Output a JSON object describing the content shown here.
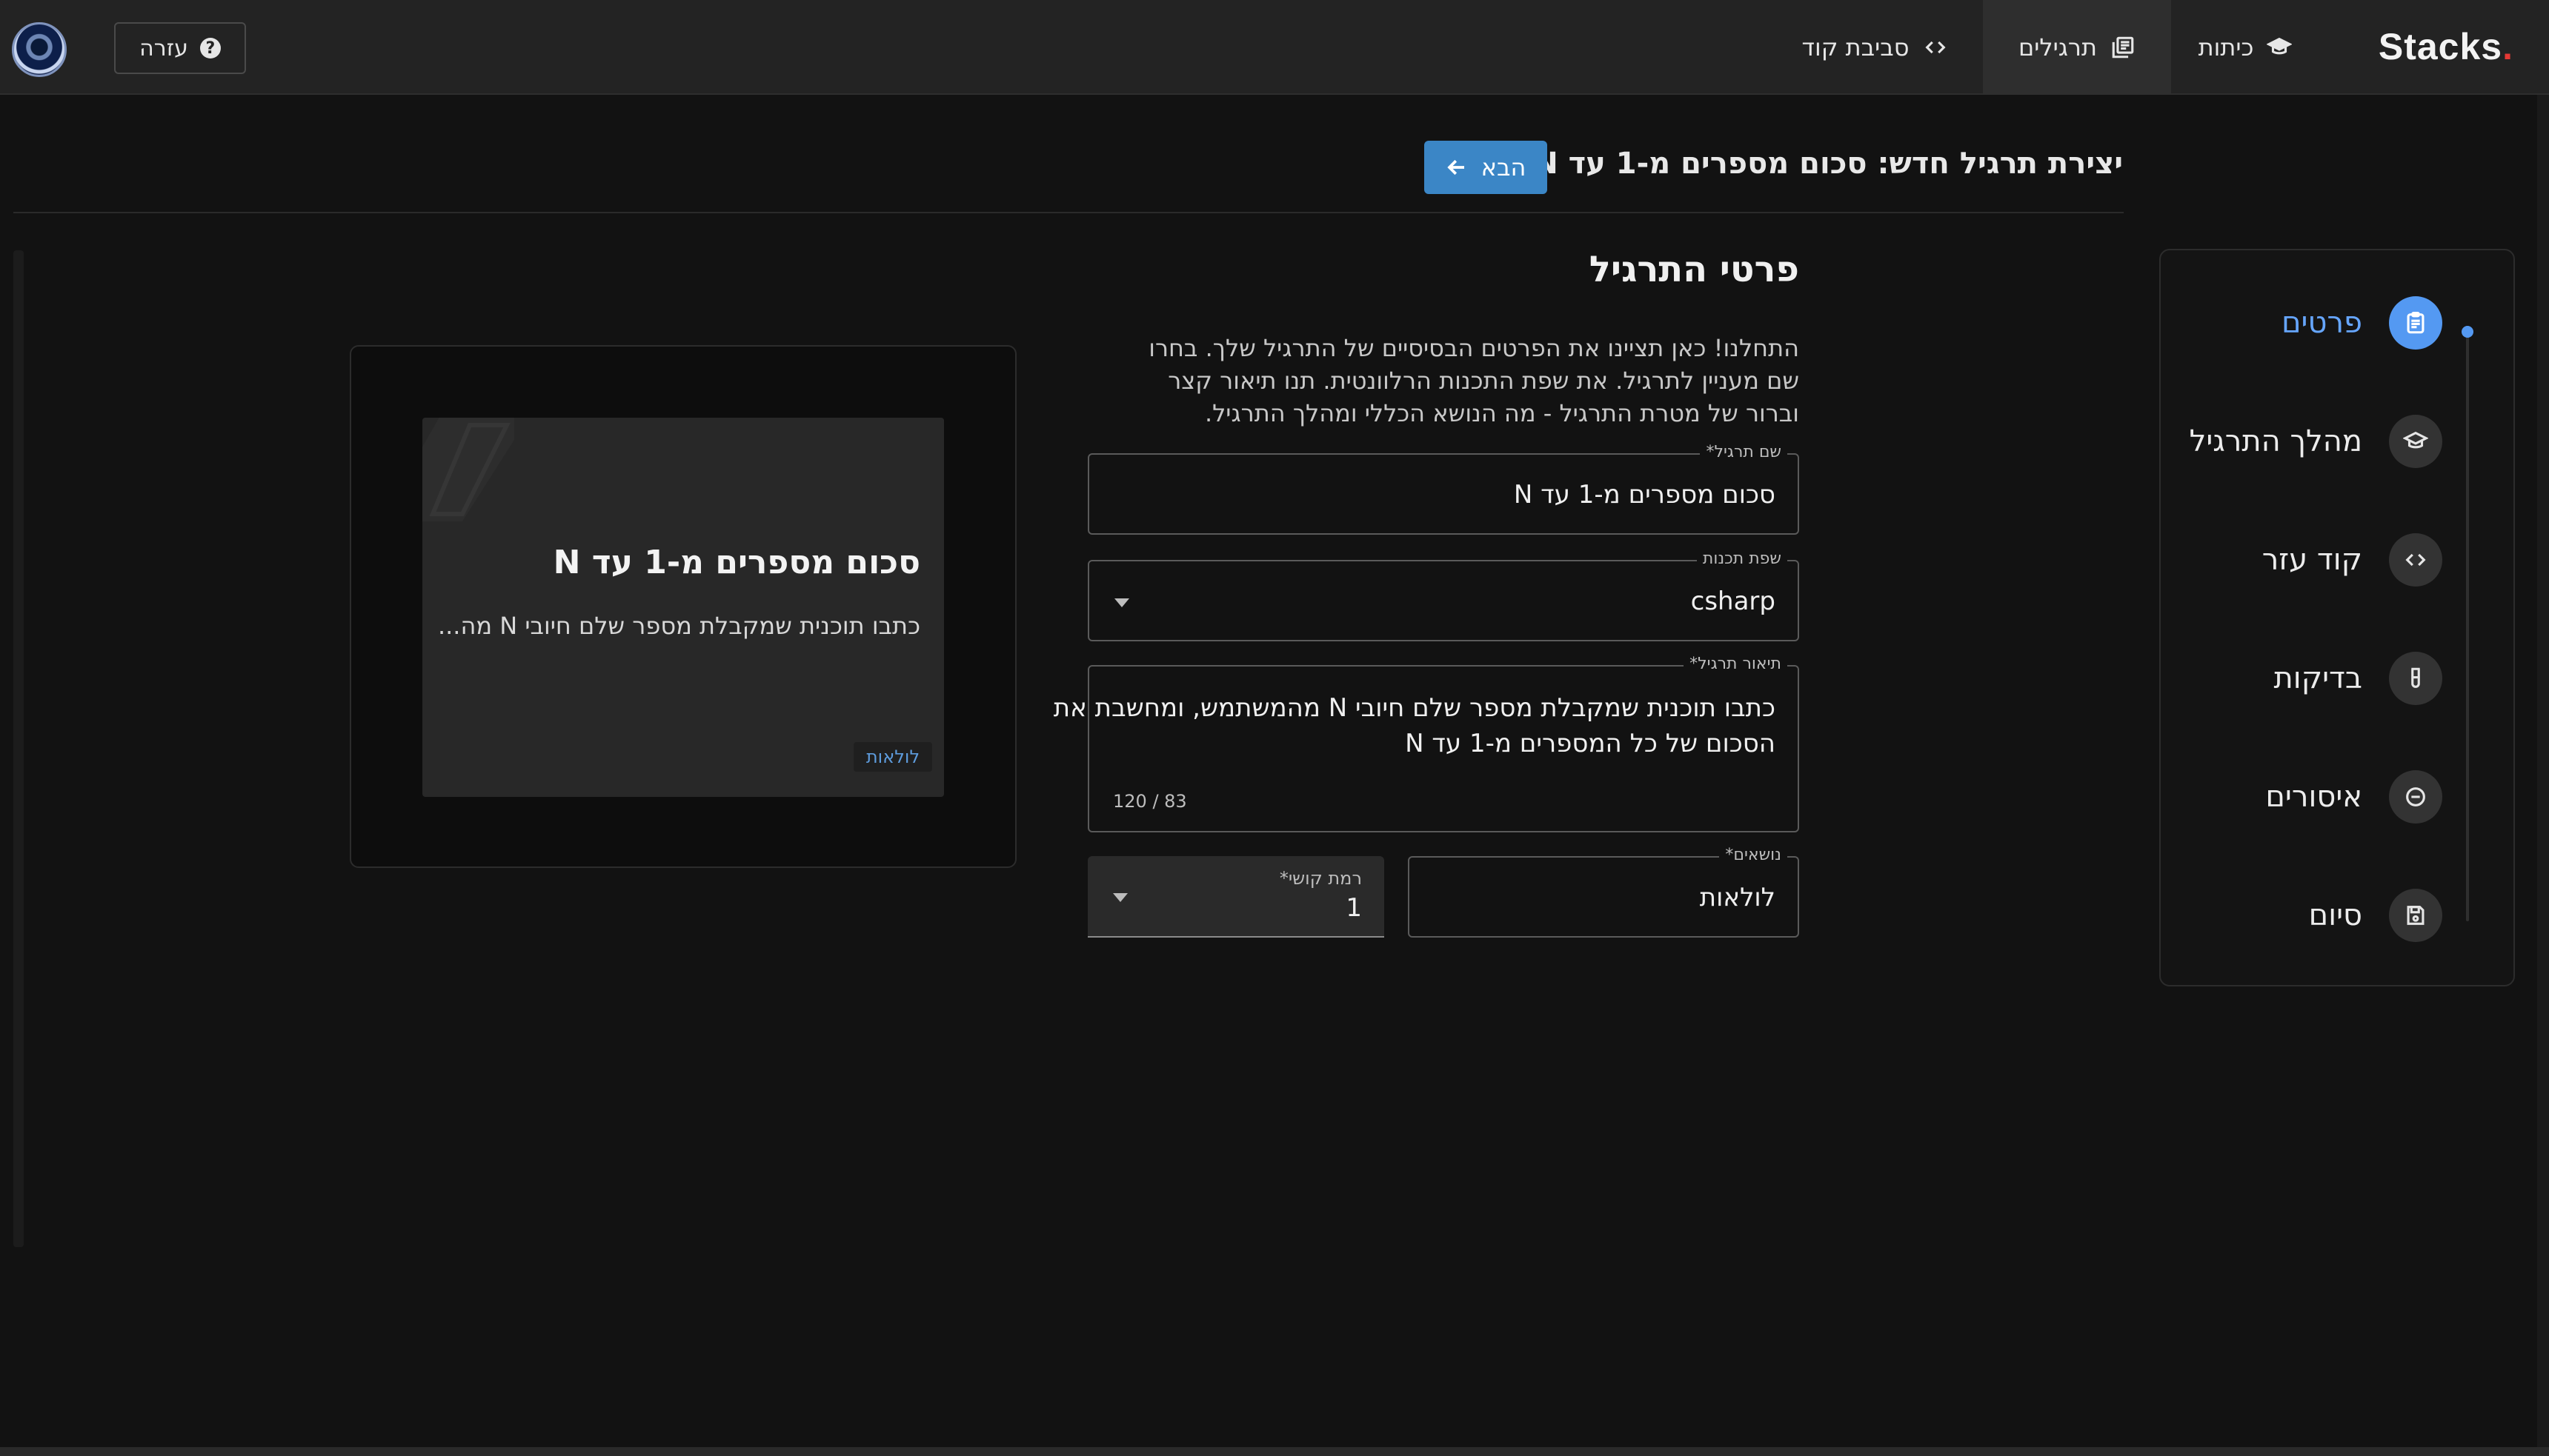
{
  "app": {
    "brand": "Stacks",
    "brand_dot": "."
  },
  "nav": {
    "classes": "כיתות",
    "exercises": "תרגילים",
    "code_env": "סביבת קוד",
    "help": "עזרה",
    "help_icon_glyph": "?"
  },
  "header": {
    "title": "יצירת תרגיל חדש: סכום מספרים מ-1 עד N",
    "next_label": "הבא"
  },
  "steps": [
    {
      "label": "פרטים",
      "icon": "clipboard-icon",
      "active": true
    },
    {
      "label": "מהלך התרגיל",
      "icon": "graduation-cap-icon",
      "active": false
    },
    {
      "label": "קוד עזר",
      "icon": "code-icon",
      "active": false
    },
    {
      "label": "בדיקות",
      "icon": "test-tube-icon",
      "active": false
    },
    {
      "label": "איסורים",
      "icon": "minus-circle-icon",
      "active": false
    },
    {
      "label": "סיום",
      "icon": "save-icon",
      "active": false
    }
  ],
  "section": {
    "title": "פרטי התרגיל",
    "description": "התחלנו! כאן תציינו את הפרטים הבסיסיים של התרגיל שלך. בחרו שם מעניין לתרגיל. את שפת התכנות הרלוונטית. תנו תיאור קצר וברור של מטרת התרגיל - מה הנושא הכללי ומהלך התרגיל."
  },
  "form": {
    "name_label": "שם תרגיל*",
    "name_value": "סכום מספרים מ-1 עד N",
    "language_label": "שפת תכנות",
    "language_value": "csharp",
    "description_label": "תיאור תרגיל*",
    "description_line1": "כתבו תוכנית שמקבלת מספר שלם חיובי N מהמשתמש, ומחשבת את",
    "description_line2": "הסכום של כל המספרים מ-1 עד N",
    "char_counter": "120 / 83",
    "topics_label": "נושאים*",
    "topics_value": "לולאות",
    "difficulty_label": "רמת קושי*",
    "difficulty_value": "1"
  },
  "preview": {
    "title": "סכום מספרים מ-1 עד N",
    "text": "כתבו תוכנית שמקבלת מספר שלם חיובי N מה...",
    "tag": "לולאות"
  },
  "colors": {
    "accent": "#5499f2",
    "button": "#3b86c6",
    "background": "#121212"
  }
}
